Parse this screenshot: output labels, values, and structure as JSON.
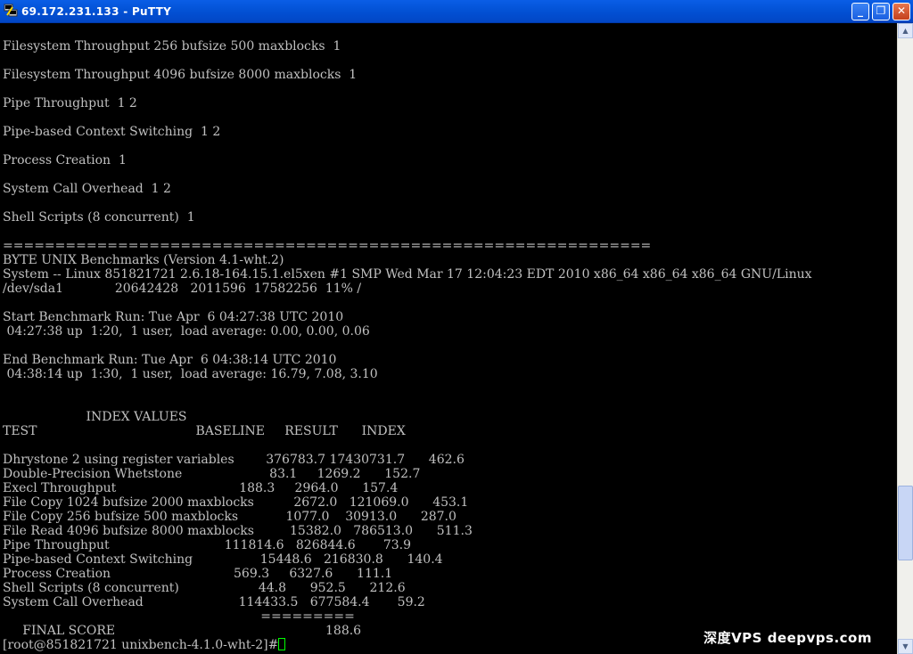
{
  "window": {
    "title": "69.172.231.133 - PuTTY",
    "buttons": {
      "minimize": "_",
      "maximize": "❐",
      "close": "✕"
    }
  },
  "terminal": {
    "lines": [
      "Filesystem Throughput 256 bufsize 500 maxblocks  1",
      "",
      "Filesystem Throughput 4096 bufsize 8000 maxblocks  1",
      "",
      "Pipe Throughput  1 2",
      "",
      "Pipe-based Context Switching  1 2",
      "",
      "Process Creation  1",
      "",
      "System Call Overhead  1 2",
      "",
      "Shell Scripts (8 concurrent)  1",
      "",
      "==============================================================",
      "BYTE UNIX Benchmarks (Version 4.1-wht.2)",
      "System -- Linux 851821721 2.6.18-164.15.1.el5xen #1 SMP Wed Mar 17 12:04:23 EDT 2010 x86_64 x86_64 x86_64 GNU/Linux",
      "/dev/sda1             20642428   2011596  17582256  11% /",
      "",
      "Start Benchmark Run: Tue Apr  6 04:27:38 UTC 2010",
      " 04:27:38 up  1:20,  1 user,  load average: 0.00, 0.00, 0.06",
      "",
      "End Benchmark Run: Tue Apr  6 04:38:14 UTC 2010",
      " 04:38:14 up  1:30,  1 user,  load average: 16.79, 7.08, 3.10",
      "",
      "",
      "                     INDEX VALUES",
      "TEST                                        BASELINE     RESULT      INDEX",
      "",
      "Dhrystone 2 using register variables        376783.7 17430731.7      462.6",
      "Double-Precision Whetstone                      83.1     1269.2      152.7",
      "Execl Throughput                               188.3     2964.0      157.4",
      "File Copy 1024 bufsize 2000 maxblocks          2672.0   121069.0      453.1",
      "File Copy 256 bufsize 500 maxblocks            1077.0    30913.0      287.0",
      "File Read 4096 bufsize 8000 maxblocks         15382.0   786513.0      511.3",
      "Pipe Throughput                             111814.6   826844.6       73.9",
      "Pipe-based Context Switching                 15448.6   216830.8      140.4",
      "Process Creation                               569.3     6327.6      111.1",
      "Shell Scripts (8 concurrent)                    44.8      952.5      212.6",
      "System Call Overhead                        114433.5   677584.4       59.2",
      "                                                                 =========",
      "     FINAL SCORE                                                     188.6"
    ],
    "prompt": "[root@851821721 unixbench-4.1.0-wht-2]#"
  },
  "watermark": "深度VPS  deepvps.com",
  "scrollbar": {
    "position_fraction": 0.85
  }
}
